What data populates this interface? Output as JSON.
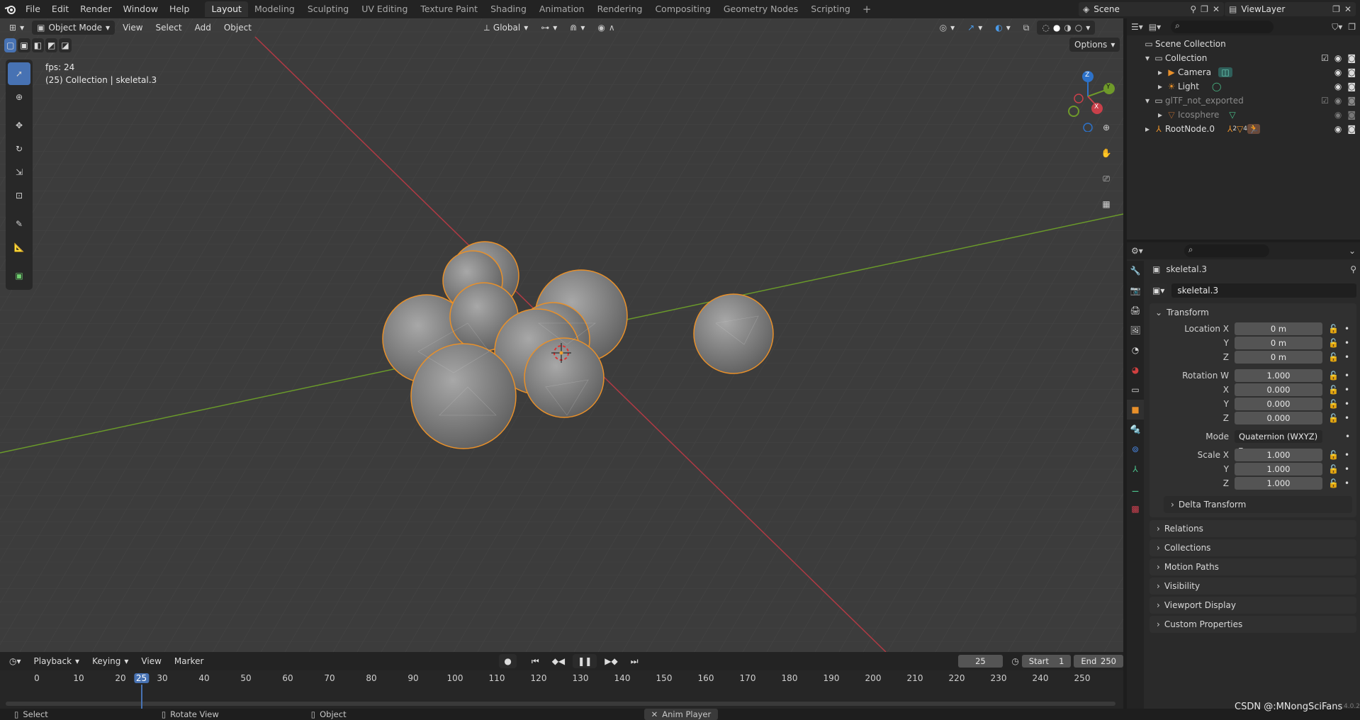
{
  "app": {
    "logo_icon": "blender-logo-icon"
  },
  "menu": [
    "File",
    "Edit",
    "Render",
    "Window",
    "Help"
  ],
  "workspaces": {
    "tabs": [
      "Layout",
      "Modeling",
      "Sculpting",
      "UV Editing",
      "Texture Paint",
      "Shading",
      "Animation",
      "Rendering",
      "Compositing",
      "Geometry Nodes",
      "Scripting"
    ],
    "active": "Layout",
    "add": "+"
  },
  "scene": {
    "name": "Scene",
    "view_layer": "ViewLayer"
  },
  "viewport": {
    "mode": "Object Mode",
    "menus": [
      "View",
      "Select",
      "Add",
      "Object"
    ],
    "transform_orientation": "Global",
    "options": "Options",
    "fps": "fps: 24",
    "context": "(25) Collection | skeletal.3",
    "gizmo": {
      "x": "X",
      "y": "Y",
      "z": "Z"
    }
  },
  "outliner": {
    "root": "Scene Collection",
    "items": [
      {
        "label": "Collection",
        "indent": 0
      },
      {
        "label": "Camera",
        "indent": 1
      },
      {
        "label": "Light",
        "indent": 1
      },
      {
        "label": "glTF_not_exported",
        "indent": 0
      },
      {
        "label": "Icosphere",
        "indent": 1
      },
      {
        "label": "RootNode.0",
        "indent": 0
      }
    ],
    "badge_count_1": "2",
    "badge_count_2": "4"
  },
  "properties": {
    "object_name": "skeletal.3",
    "datablock_name": "skeletal.3",
    "transform_title": "Transform",
    "location": {
      "label_x": "Location X",
      "label_y": "Y",
      "label_z": "Z",
      "x": "0 m",
      "y": "0 m",
      "z": "0 m"
    },
    "rotation": {
      "label_w": "Rotation W",
      "label_x": "X",
      "label_y": "Y",
      "label_z": "Z",
      "w": "1.000",
      "x": "0.000",
      "y": "0.000",
      "z": "0.000"
    },
    "mode": {
      "label": "Mode",
      "value": "Quaternion (WXYZ)"
    },
    "scale": {
      "label_x": "Scale X",
      "label_y": "Y",
      "label_z": "Z",
      "x": "1.000",
      "y": "1.000",
      "z": "1.000"
    },
    "delta": "Delta Transform",
    "panels": [
      "Relations",
      "Collections",
      "Motion Paths",
      "Visibility",
      "Viewport Display",
      "Custom Properties"
    ]
  },
  "timeline": {
    "menus": [
      "Playback",
      "Keying",
      "View",
      "Marker"
    ],
    "current_frame": "25",
    "start_label": "Start",
    "start": "1",
    "end_label": "End",
    "end": "250",
    "ticks": [
      "0",
      "10",
      "20",
      "25",
      "30",
      "40",
      "50",
      "60",
      "70",
      "80",
      "90",
      "100",
      "110",
      "120",
      "130",
      "140",
      "150",
      "160",
      "170",
      "180",
      "190",
      "200",
      "210",
      "220",
      "230",
      "240",
      "250"
    ],
    "frame_range": [
      0,
      250
    ],
    "frame_value": 25
  },
  "status": {
    "select": "Select",
    "rotate": "Rotate View",
    "object": "Object",
    "anim": "Anim Player",
    "watermark": "CSDN @:MNongSciFans",
    "version": "4.0.2"
  },
  "colors": {
    "accent": "#4772b3",
    "selection": "#e8902a",
    "x_axis": "#c9404a",
    "y_axis": "#6f9a2a",
    "z_axis": "#2d72c9"
  }
}
